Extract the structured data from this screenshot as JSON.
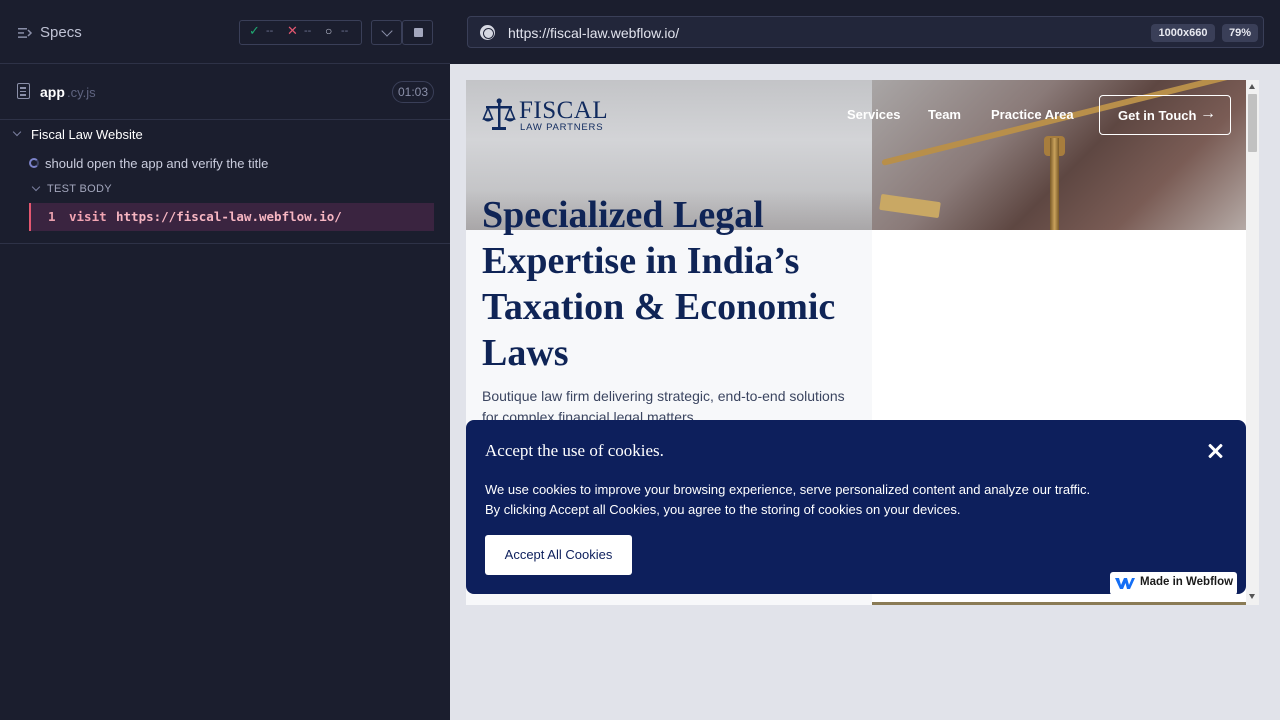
{
  "runner": {
    "specs_label": "Specs",
    "stats": {
      "passed": "--",
      "failed": "--",
      "pending": "--"
    },
    "spec_file": {
      "name": "app",
      "ext": ".cy.js",
      "duration": "01:03"
    },
    "suite_title": "Fiscal Law Website",
    "test_title": "should open the app and verify the title",
    "test_body_label": "TEST BODY",
    "command": {
      "number": "1",
      "name": "visit",
      "arg": "https://fiscal-law.webflow.io/"
    }
  },
  "aut": {
    "url": "https://fiscal-law.webflow.io/",
    "viewport": "1000x660",
    "zoom": "79%"
  },
  "site": {
    "logo_main": "FISCAL",
    "logo_sub": "LAW PARTNERS",
    "nav": [
      "Services",
      "Team",
      "Practice Area"
    ],
    "cta": "Get in Touch",
    "headline": "Specialized Legal Expertise in India’s Taxation & Economic Laws",
    "subtext": "Boutique law firm delivering strategic, end-to-end solutions for complex financial legal matters.",
    "cookie": {
      "title": "Accept the use of cookies.",
      "text_line1": "We use cookies to improve your browsing experience, serve personalized content and analyze our traffic.",
      "text_line2": "By clicking Accept all Cookies, you agree to the storing of cookies on your devices.",
      "button": "Accept All Cookies"
    },
    "webflow_badge": "Made in Webflow"
  },
  "colors": {
    "runner_bg": "#1b1e2e",
    "navy": "#0d1f5c",
    "heading": "#0f2456",
    "command_accent": "#e45770",
    "pass": "#1fa971",
    "fail": "#e45770"
  },
  "icons": [
    "specs-toggle-icon",
    "check-icon",
    "x-icon",
    "spinner-icon",
    "chevron-down-icon",
    "stop-icon",
    "file-icon",
    "globe-icon",
    "scales-icon",
    "arrow-right-icon",
    "close-icon",
    "webflow-logo-icon"
  ]
}
